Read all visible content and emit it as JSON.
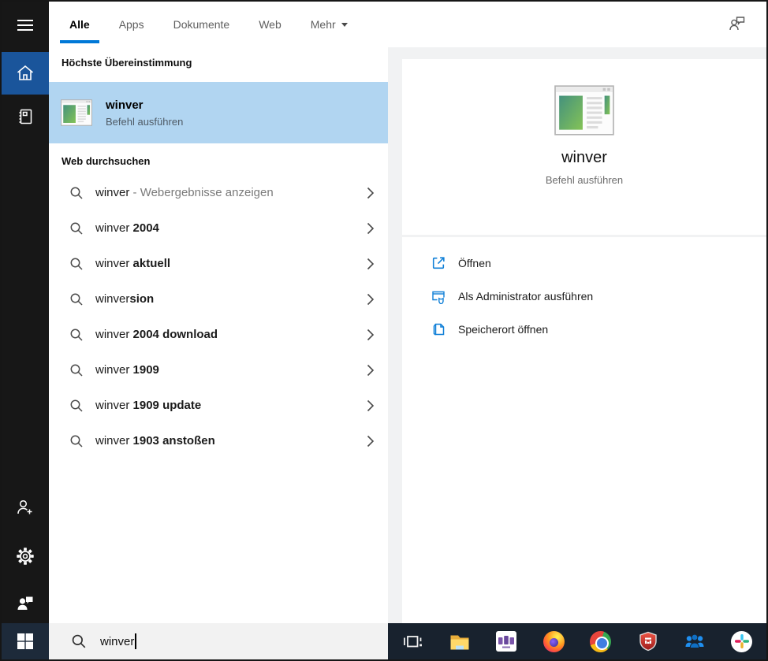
{
  "colors": {
    "accent": "#0078d7",
    "selection": "#b1d5f1",
    "sidebar": "#171717",
    "sidebar_active": "#1a559b",
    "taskbar": "#18222e",
    "panel_gray": "#f1f2f3",
    "searchbox_gray": "#f2f2f2"
  },
  "topbar": {
    "tabs": [
      {
        "label": "Alle",
        "active": true
      },
      {
        "label": "Apps",
        "active": false
      },
      {
        "label": "Dokumente",
        "active": false
      },
      {
        "label": "Web",
        "active": false
      },
      {
        "label": "Mehr",
        "active": false,
        "dropdown": true
      }
    ],
    "corner_icon": "user-feedback-icon"
  },
  "sidebar": {
    "icons": [
      "menu-icon",
      "home-icon",
      "journal-icon",
      "add-user-icon",
      "settings-gear-icon",
      "feedback-icon"
    ]
  },
  "results": {
    "best_header": "Höchste Übereinstimmung",
    "best": {
      "title": "winver",
      "subtitle": "Befehl ausführen",
      "icon": "winver-app-icon"
    },
    "web_header": "Web durchsuchen",
    "suggestions": [
      {
        "typed": "winver",
        "bold": "",
        "note": " - Webergebnisse anzeigen"
      },
      {
        "typed": "winver",
        "bold": " 2004",
        "note": ""
      },
      {
        "typed": "winver",
        "bold": " aktuell",
        "note": ""
      },
      {
        "typed": "winver",
        "bold": "sion",
        "note": ""
      },
      {
        "typed": "winver",
        "bold": " 2004 download",
        "note": ""
      },
      {
        "typed": "winver",
        "bold": " 1909",
        "note": ""
      },
      {
        "typed": "winver",
        "bold": " 1909 update",
        "note": ""
      },
      {
        "typed": "winver",
        "bold": " 1903 anstoßen",
        "note": ""
      }
    ]
  },
  "details": {
    "title": "winver",
    "subtitle": "Befehl ausführen",
    "icon": "winver-app-icon",
    "actions": [
      {
        "label": "Öffnen",
        "icon": "open-icon"
      },
      {
        "label": "Als Administrator ausführen",
        "icon": "run-as-admin-icon"
      },
      {
        "label": "Speicherort öffnen",
        "icon": "open-file-location-icon"
      }
    ]
  },
  "searchbox": {
    "value": "winver",
    "icon": "search-icon"
  },
  "taskbar": {
    "start": "windows-start-icon",
    "icons": [
      "task-view-icon",
      "file-explorer-icon",
      "purple-app-icon",
      "firefox-icon",
      "chrome-icon",
      "security-shield-icon",
      "notes-people-icon",
      "slack-icon"
    ]
  }
}
